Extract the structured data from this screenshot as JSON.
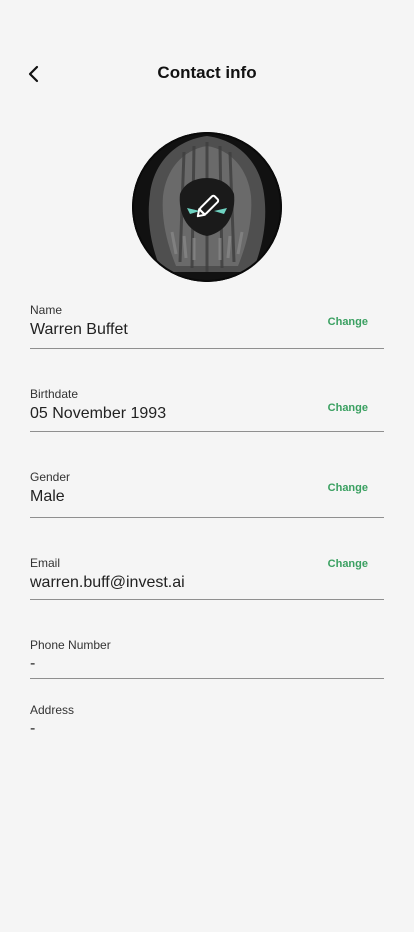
{
  "header": {
    "title": "Contact info",
    "back_icon": "chevron-left-icon"
  },
  "avatar": {
    "edit_icon": "pencil-icon"
  },
  "fields": [
    {
      "label": "Name",
      "value": "Warren Buffet",
      "action": "Change"
    },
    {
      "label": "Birthdate",
      "value": "05 November 1993",
      "action": "Change"
    },
    {
      "label": "Gender",
      "value": "Male",
      "action": "Change"
    },
    {
      "label": "Email",
      "value": "warren.buff@invest.ai",
      "action": "Change"
    },
    {
      "label": "Phone Number",
      "value": "-"
    },
    {
      "label": "Address",
      "value": "-"
    }
  ],
  "colors": {
    "background": "#f5f5f5",
    "accent": "#3aa061",
    "divider": "#8f8f8f"
  }
}
